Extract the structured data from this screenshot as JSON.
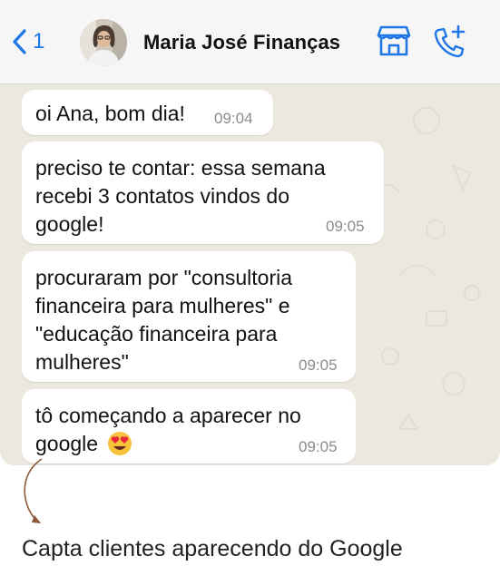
{
  "header": {
    "back_count": "1",
    "contact_name": "Maria José Finanças"
  },
  "messages": [
    {
      "lines": [
        "oi Ana, bom dia!"
      ],
      "time": "09:04"
    },
    {
      "lines": [
        "preciso te contar: essa semana",
        "recebi 3 contatos vindos do",
        "google!"
      ],
      "time": "09:05"
    },
    {
      "lines": [
        "procuraram por \"consultoria",
        "financeira para mulheres\" e",
        "\"educação financeira para",
        "mulheres\""
      ],
      "time": "09:05"
    },
    {
      "lines": [
        "tô começando a aparecer no",
        "google"
      ],
      "time": "09:05",
      "emoji": "heart-eyes-emoji"
    }
  ],
  "caption": "Capta clientes aparecendo do Google",
  "colors": {
    "accent_blue": "#1e77e5",
    "chat_background": "#ece7df",
    "bubble": "#ffffff",
    "arrow": "#8a5a3a"
  }
}
